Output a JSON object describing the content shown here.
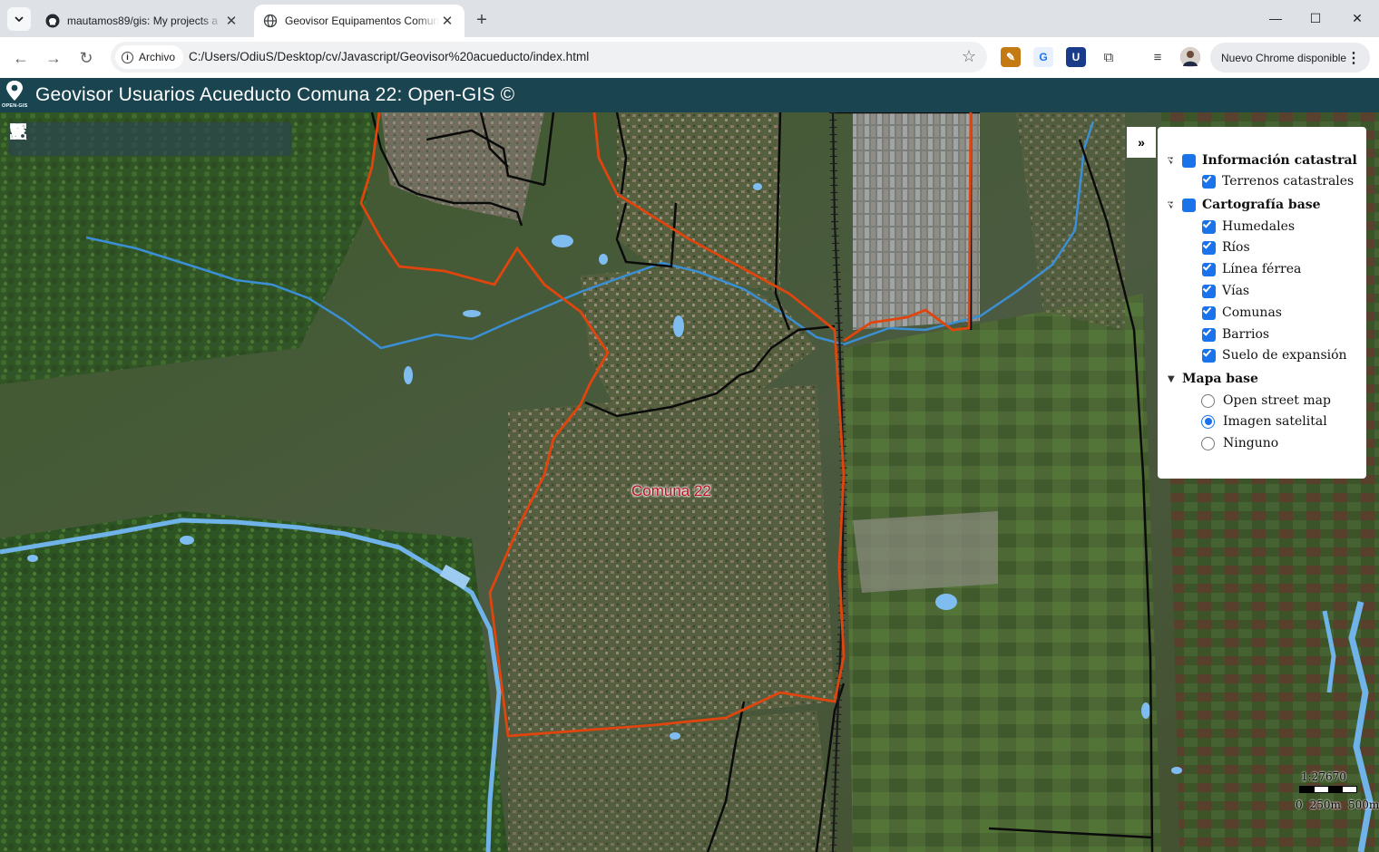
{
  "browser": {
    "tabs": [
      {
        "title": "mautamos89/gis: My projects a",
        "icon": "github-icon",
        "active": false
      },
      {
        "title": "Geovisor Equipamentos Comun",
        "icon": "globe-icon",
        "active": true
      }
    ],
    "address": {
      "security_chip": "Archivo",
      "url": "C:/Users/OdiuS/Desktop/cv/Javascript/Geovisor%20acueducto/index.html"
    },
    "update_button": "Nuevo Chrome disponible"
  },
  "app": {
    "title": "Geovisor Usuarios Acueducto Comuna 22: Open-GIS ©",
    "logo_text": "OPEN-GIS",
    "colors": {
      "header": "#1b4451",
      "boundary": "#e0450e",
      "rivers": "#3b8fd4"
    }
  },
  "map": {
    "label": "Comuna 22",
    "tools": [
      {
        "name": "home-tool",
        "icon": "home-icon"
      },
      {
        "name": "fullscreen-tool",
        "icon": "fullscreen-icon"
      },
      {
        "name": "info-tool",
        "icon": "info-icon"
      },
      {
        "name": "measure-length-tool",
        "icon": "ruler-icon"
      },
      {
        "name": "measure-area-tool",
        "icon": "area-icon"
      },
      {
        "name": "zoom-in-tool",
        "icon": "zoom-in-icon"
      },
      {
        "name": "search-tool",
        "icon": "search-icon"
      },
      {
        "name": "query-tool",
        "icon": "database-icon"
      }
    ],
    "scale": {
      "ratio": "1:27670",
      "ticks": [
        "0",
        "250m",
        "500m"
      ]
    }
  },
  "layers": {
    "collapse_label": "»",
    "groups": [
      {
        "title": "Información catastral",
        "checked": true,
        "items": [
          {
            "label": "Terrenos catastrales",
            "checked": true
          }
        ]
      },
      {
        "title": "Cartografía base",
        "checked": true,
        "items": [
          {
            "label": "Humedales",
            "checked": true
          },
          {
            "label": "Ríos",
            "checked": true
          },
          {
            "label": "Línea férrea",
            "checked": true
          },
          {
            "label": "Vías",
            "checked": true
          },
          {
            "label": "Comunas",
            "checked": true
          },
          {
            "label": "Barrios",
            "checked": true
          },
          {
            "label": "Suelo de expansión",
            "checked": true
          }
        ]
      },
      {
        "title": "Mapa base",
        "items": [
          {
            "label": "Open street map",
            "selected": false
          },
          {
            "label": "Imagen satelital",
            "selected": true
          },
          {
            "label": "Ninguno",
            "selected": false
          }
        ]
      }
    ]
  }
}
